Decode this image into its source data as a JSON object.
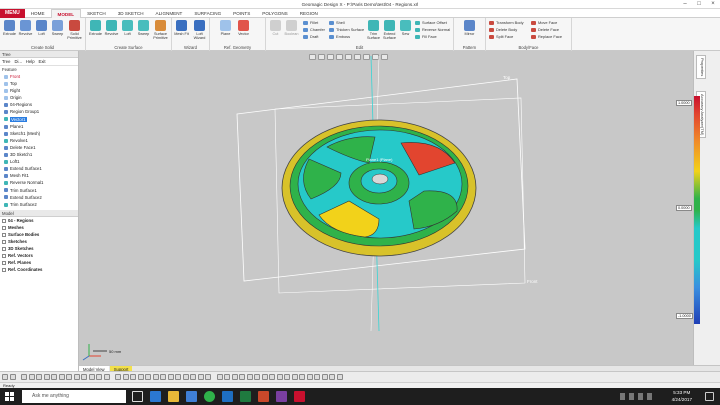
{
  "window": {
    "title": "Geomagic Design X - P:\\Paris Demo\\test\\04 - Regions.xrl"
  },
  "tabs": [
    "MENU",
    "HOME",
    "MODEL",
    "SKETCH",
    "3D SKETCH",
    "ALIGNMENT",
    "SURFACING",
    "POINTS",
    "POLYGONS",
    "REGION"
  ],
  "ribbon": {
    "groups": [
      {
        "label": "Create Solid",
        "buttons": [
          "Extrude",
          "Revolve",
          "Loft",
          "Sweep",
          "Solid Primitive"
        ]
      },
      {
        "label": "Create Surface",
        "buttons": [
          "Extrude",
          "Revolve",
          "Loft",
          "Sweep",
          "Surface Primitive"
        ]
      },
      {
        "label": "Wizard",
        "buttons": [
          "Mesh Fit",
          "Loft Wizard"
        ]
      },
      {
        "label": "Ref. Geometry",
        "buttons": [
          "Plane",
          "Vector"
        ]
      },
      {
        "label": "Edit",
        "buttons": [
          "Cut",
          "Boolean",
          "Fillet",
          "Chamfer",
          "Draft",
          "Shell",
          "Thicken Surface",
          "Emboss",
          "Trim Surface",
          "Extend Surface",
          "Sew",
          "Surface Offset",
          "Reverse Normal",
          "Fill Face"
        ]
      },
      {
        "label": "Pattern",
        "buttons": [
          "Mirror"
        ]
      },
      {
        "label": "Body/Face",
        "buttons": [
          "Transform Body",
          "Delete Body",
          "Split Face",
          "Move Face",
          "Delete Face",
          "Replace Face"
        ]
      }
    ]
  },
  "tree": {
    "panel_title": "Tree",
    "tools": [
      "Tree",
      "Di...",
      "Help",
      "Exit"
    ],
    "feature_header": "Feature",
    "features": [
      {
        "label": "Front",
        "style": "red"
      },
      {
        "label": "Top",
        "style": ""
      },
      {
        "label": "Right",
        "style": ""
      },
      {
        "label": "Origin",
        "style": ""
      },
      {
        "label": "04-Regions",
        "style": ""
      },
      {
        "label": "Region Group1",
        "style": ""
      },
      {
        "label": "Vector1",
        "style": "sel"
      },
      {
        "label": "Plane1",
        "style": ""
      },
      {
        "label": "Sketch1 (Mesh)",
        "style": ""
      },
      {
        "label": "Revolve1",
        "style": ""
      },
      {
        "label": "Delete Face1",
        "style": ""
      },
      {
        "label": "3D Sketch1",
        "style": ""
      },
      {
        "label": "Loft1",
        "style": ""
      },
      {
        "label": "Extend Surface1",
        "style": ""
      },
      {
        "label": "Mesh Fit1",
        "style": ""
      },
      {
        "label": "Reverse Normal1",
        "style": ""
      },
      {
        "label": "Trim Surface1",
        "style": ""
      },
      {
        "label": "Extend Surface2",
        "style": ""
      },
      {
        "label": "Trim Surface2",
        "style": ""
      }
    ],
    "model_header": "Model",
    "model": [
      {
        "label": "04 - Regions",
        "style": "bold"
      },
      {
        "label": "Meshes",
        "style": "bold"
      },
      {
        "label": "Surface Bodies",
        "style": "bold"
      },
      {
        "label": "Sketches",
        "style": "bold"
      },
      {
        "label": "3D Sketches",
        "style": "bold"
      },
      {
        "label": "Ref. Vectors",
        "style": "bold"
      },
      {
        "label": "Ref. Planes",
        "style": "bold"
      },
      {
        "label": "Ref. Coordinates",
        "style": "bold"
      }
    ]
  },
  "viewport": {
    "labels": {
      "top_plane": "Top",
      "front_plane": "Front",
      "center_label": "Plane1 (Plane)",
      "scale": "50 mm"
    }
  },
  "side_tabs": [
    "Properties",
    "Accuracy Analyzer(TM)"
  ],
  "color_scale": {
    "labels": [
      "1.0000",
      "0.0000",
      "-1.0000"
    ]
  },
  "view_tabs": [
    "Model View",
    "Support"
  ],
  "status": {
    "text": "Ready"
  },
  "taskbar": {
    "search_placeholder": "Ask me anything",
    "time": "5:33 PM",
    "date": "4/24/2017"
  },
  "colors": {
    "accent": "#c8102e",
    "viewport_bg": "#c8c8c8",
    "part_green": "#2fb24a",
    "part_cyan": "#26c9c9",
    "part_yellow": "#f2d21a",
    "part_red": "#e2452f"
  }
}
